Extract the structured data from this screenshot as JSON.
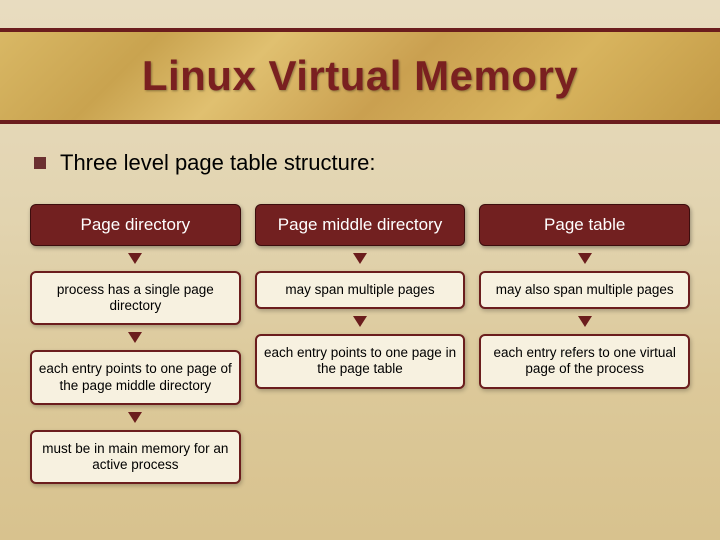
{
  "title": "Linux Virtual Memory",
  "bullet": "Three level page table structure:",
  "columns": [
    {
      "header": "Page directory",
      "boxes": [
        "process has a single page directory",
        "each entry points to one page of the page middle directory",
        "must be in main memory for an active process"
      ]
    },
    {
      "header": "Page middle directory",
      "boxes": [
        "may span multiple pages",
        "each entry points to one page in the page table"
      ]
    },
    {
      "header": "Page table",
      "boxes": [
        "may also span multiple pages",
        "each entry refers to one virtual page of the process"
      ]
    }
  ]
}
